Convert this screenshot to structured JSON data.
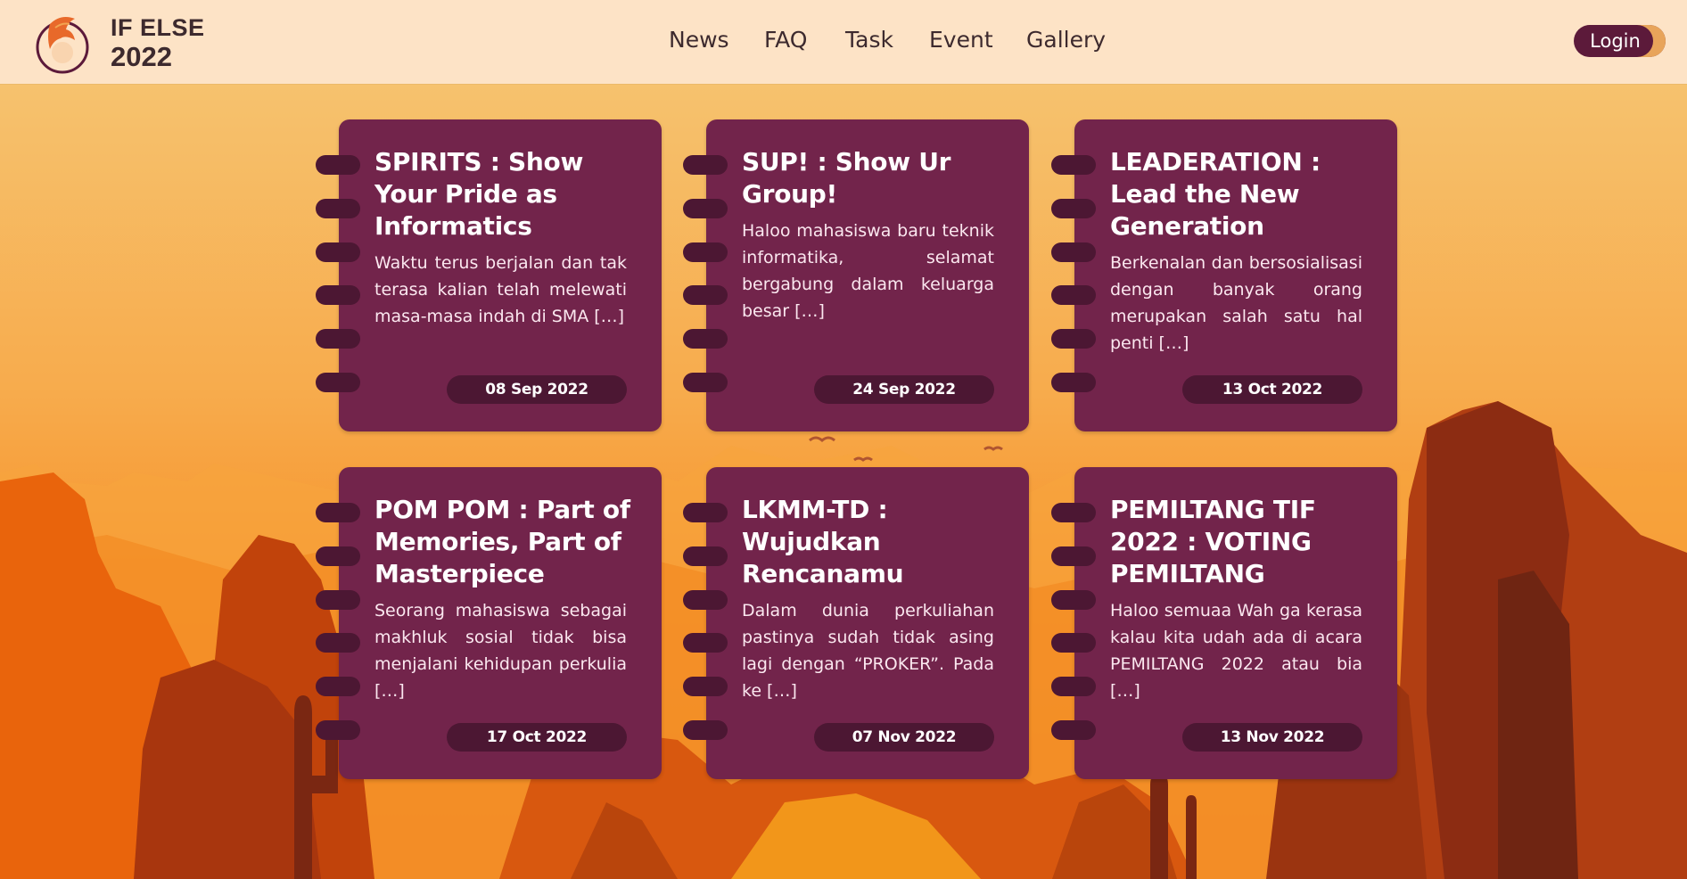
{
  "brand": {
    "line1": "IF ELSE",
    "line2": "2022"
  },
  "nav": [
    {
      "label": "News"
    },
    {
      "label": "FAQ"
    },
    {
      "label": "Task"
    },
    {
      "label": "Event"
    },
    {
      "label": "Gallery"
    }
  ],
  "login_label": "Login",
  "cards": [
    {
      "title": "SPIRITS : Show Your Pride as Informatics",
      "text": "Waktu terus berjalan dan tak terasa kalian telah melewati masa-masa indah di SMA […]",
      "date": "08 Sep 2022"
    },
    {
      "title": "SUP! : Show Ur Group!",
      "text": "Haloo mahasiswa baru teknik informatika, selamat bergabung dalam keluarga besar […]",
      "date": "24 Sep 2022"
    },
    {
      "title": "LEADERATION : Lead the New Generation",
      "text": "Berkenalan dan bersosialisasi dengan banyak orang merupakan salah satu hal penti […]",
      "date": "13 Oct 2022"
    },
    {
      "title": "POM POM : Part of Memories, Part of Masterpiece",
      "text": "Seorang mahasiswa sebagai makhluk sosial tidak bisa menjalani kehidupan perkulia […]",
      "date": "17 Oct 2022"
    },
    {
      "title": "LKMM-TD : Wujudkan Rencanamu",
      "text": "Dalam dunia perkuliahan pastinya sudah tidak asing lagi dengan “PROKER”. Pada ke […]",
      "date": "07 Nov 2022"
    },
    {
      "title": "PEMILTANG TIF 2022 : VOTING PEMILTANG",
      "text": "Haloo semuaa Wah ga kerasa kalau kita udah ada di acara PEMILTANG 2022 atau bia […]",
      "date": "13 Nov 2022"
    }
  ],
  "colors": {
    "header_bg": "#fde3c6",
    "card_bg": "#72244b",
    "card_dark": "#4c1733",
    "login_bg": "#5c1a3a"
  }
}
